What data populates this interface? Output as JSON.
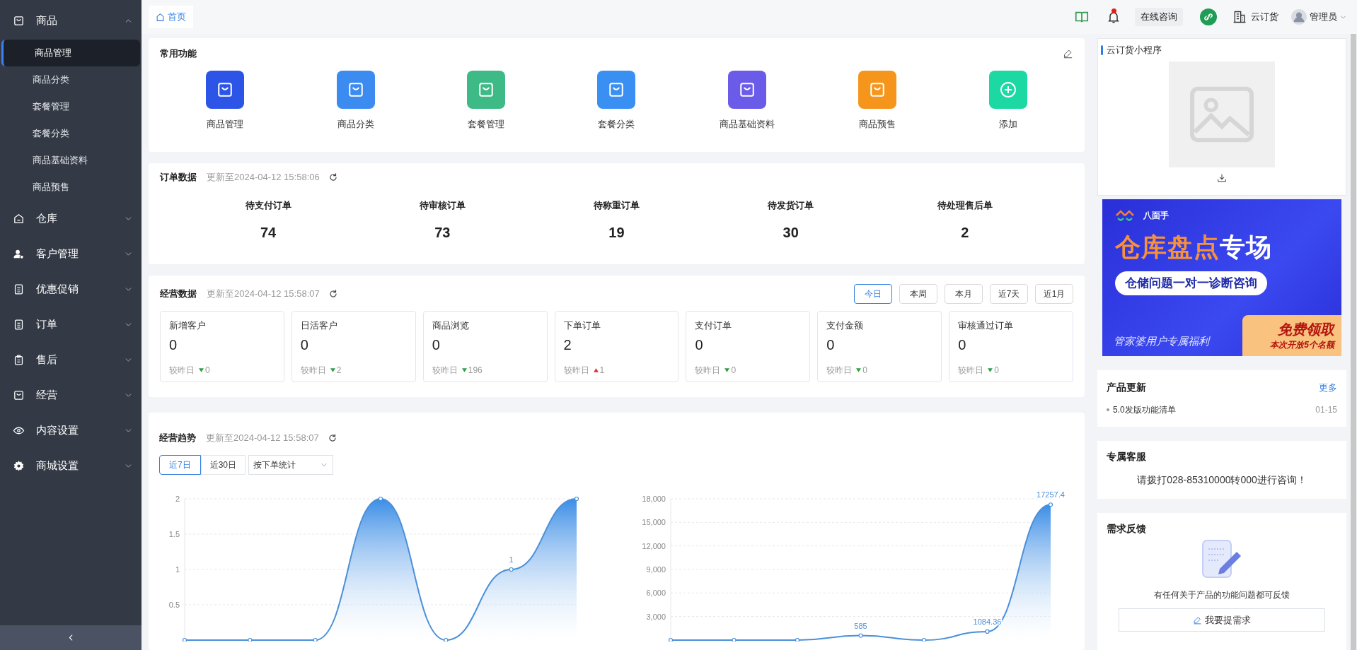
{
  "sidebar": {
    "items": [
      {
        "label": "商品",
        "expanded": true,
        "children": [
          {
            "label": "商品管理",
            "selected": true
          },
          {
            "label": "商品分类",
            "selected": false
          },
          {
            "label": "套餐管理",
            "selected": false
          },
          {
            "label": "套餐分类",
            "selected": false
          },
          {
            "label": "商品基础资料",
            "selected": false
          },
          {
            "label": "商品预售",
            "selected": false
          }
        ]
      },
      {
        "label": "仓库",
        "expanded": false
      },
      {
        "label": "客户管理",
        "expanded": false
      },
      {
        "label": "优惠促销",
        "expanded": false
      },
      {
        "label": "订单",
        "expanded": false
      },
      {
        "label": "售后",
        "expanded": false
      },
      {
        "label": "经营",
        "expanded": false
      },
      {
        "label": "内容设置",
        "expanded": false
      },
      {
        "label": "商城设置",
        "expanded": false
      }
    ]
  },
  "topbar": {
    "tabs": [
      {
        "label": "首页",
        "selected": true
      }
    ],
    "notification": true,
    "consult_button": "在线咨询",
    "company": "云订货",
    "user": "管理员"
  },
  "common_functions": {
    "title": "常用功能",
    "items": [
      {
        "label": "商品管理",
        "color": "#2c55e8",
        "kind": "shortcut"
      },
      {
        "label": "商品分类",
        "color": "#3b8bf0",
        "kind": "shortcut"
      },
      {
        "label": "套餐管理",
        "color": "#3dba86",
        "kind": "shortcut"
      },
      {
        "label": "套餐分类",
        "color": "#3a8ff2",
        "kind": "shortcut"
      },
      {
        "label": "商品基础资料",
        "color": "#6a5be8",
        "kind": "shortcut"
      },
      {
        "label": "商品预售",
        "color": "#f5951c",
        "kind": "shortcut"
      },
      {
        "label": "添加",
        "color": "#1cd8a2",
        "kind": "add"
      }
    ]
  },
  "order_data": {
    "title": "订单数据",
    "updated": "更新至2024-04-12 15:58:06",
    "stats": [
      {
        "label": "待支付订单",
        "value": "74"
      },
      {
        "label": "待审核订单",
        "value": "73"
      },
      {
        "label": "待称重订单",
        "value": "19"
      },
      {
        "label": "待发货订单",
        "value": "30"
      },
      {
        "label": "待处理售后单",
        "value": "2"
      }
    ]
  },
  "business_data": {
    "title": "经营数据",
    "updated": "更新至2024-04-12 15:58:07",
    "ranges": [
      {
        "label": "今日",
        "selected": true
      },
      {
        "label": "本周",
        "selected": false
      },
      {
        "label": "本月",
        "selected": false
      },
      {
        "label": "近7天",
        "selected": false
      },
      {
        "label": "近1月",
        "selected": false
      }
    ],
    "metrics": [
      {
        "label": "新增客户",
        "value": "0",
        "compare": "较昨日",
        "kind": "decrease",
        "change": "0"
      },
      {
        "label": "日活客户",
        "value": "0",
        "compare": "较昨日",
        "kind": "decrease",
        "change": "2"
      },
      {
        "label": "商品浏览",
        "value": "0",
        "compare": "较昨日",
        "kind": "decrease",
        "change": "196"
      },
      {
        "label": "下单订单",
        "value": "2",
        "compare": "较昨日",
        "kind": "increase",
        "change": "1"
      },
      {
        "label": "支付订单",
        "value": "0",
        "compare": "较昨日",
        "kind": "decrease",
        "change": "0"
      },
      {
        "label": "支付金额",
        "value": "0",
        "compare": "较昨日",
        "kind": "decrease",
        "change": "0"
      },
      {
        "label": "审核通过订单",
        "value": "0",
        "compare": "较昨日",
        "kind": "decrease",
        "change": "0"
      }
    ]
  },
  "trend": {
    "title": "经营趋势",
    "updated": "更新至2024-04-12 15:58:07",
    "periods": [
      {
        "label": "近7日",
        "selected": true
      },
      {
        "label": "近30日",
        "selected": false
      }
    ],
    "select": "按下单统计",
    "charts": [
      {
        "chart_data": {
          "type": "area",
          "grid": true,
          "ylim": [
            0,
            2
          ],
          "yticks": [
            {
              "value": 0.5,
              "label": "0.5"
            },
            {
              "value": 1,
              "label": "1"
            },
            {
              "value": 1.5,
              "label": "1.5"
            },
            {
              "value": 2,
              "label": "2"
            }
          ],
          "values": [
            0,
            0,
            0,
            2,
            0,
            1,
            2
          ],
          "value_labels": [
            null,
            null,
            null,
            null,
            null,
            "1",
            null
          ]
        }
      },
      {
        "chart_data": {
          "type": "area",
          "grid": true,
          "ylim": [
            0,
            18000
          ],
          "yticks": [
            {
              "value": 3000,
              "label": "3,000"
            },
            {
              "value": 6000,
              "label": "6,000"
            },
            {
              "value": 9000,
              "label": "9,000"
            },
            {
              "value": 12000,
              "label": "12,000"
            },
            {
              "value": 15000,
              "label": "15,000"
            },
            {
              "value": 18000,
              "label": "18,000"
            }
          ],
          "values": [
            0,
            0,
            0,
            585,
            0,
            1084.36,
            17257.4
          ],
          "value_labels": [
            null,
            null,
            null,
            "585",
            null,
            "1084.36",
            "17257.4"
          ]
        }
      }
    ]
  },
  "mini_program": {
    "title": "云订货小程序"
  },
  "banner": {
    "brand": "八面手",
    "headline_accent": "仓库盘点",
    "headline": "专场",
    "subtitle": "仓储问题一对一诊断咨询",
    "footer": "管家婆用户专属福利",
    "cta": "免费领取",
    "cta_note": "本次开放5个名额"
  },
  "product_updates": {
    "title": "产品更新",
    "more": "更多",
    "items": [
      {
        "title": "5.0发版功能清单",
        "date": "01-15"
      }
    ]
  },
  "service": {
    "title": "专属客服",
    "text": "请拨打028-85310000转000进行咨询！"
  },
  "feedback": {
    "title": "需求反馈",
    "text": "有任何关于产品的功能问题都可反馈",
    "button": "我要提需求"
  }
}
